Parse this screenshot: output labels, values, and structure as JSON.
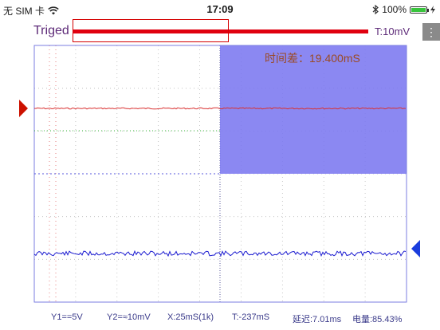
{
  "status_bar": {
    "carrier": "无 SIM 卡",
    "time": "17:09",
    "battery": "100%",
    "icons": [
      "wifi-icon",
      "bluetooth-icon",
      "battery-icon",
      "charging-icon"
    ]
  },
  "trigger": {
    "label": "Triged",
    "value": "T:10mV",
    "color": "#e0000f"
  },
  "menu_button": {
    "label": "⋮"
  },
  "measurement": {
    "time_diff": "时间差：19.400mS",
    "region_color": "#7b78f0"
  },
  "channels": {
    "ch1_color": "#d93030",
    "ch2_color": "#1c1cd0",
    "ch1_marker_color": "#cc1100",
    "ch2_marker_color": "#1a3ddd"
  },
  "readout": {
    "y1": "Y1==5V",
    "y2": "Y2=≈10mV",
    "x": "X:25mS(1k)",
    "t": "T:-237mS",
    "delay": "延迟:7.01ms",
    "power": "电量:85.43%"
  }
}
